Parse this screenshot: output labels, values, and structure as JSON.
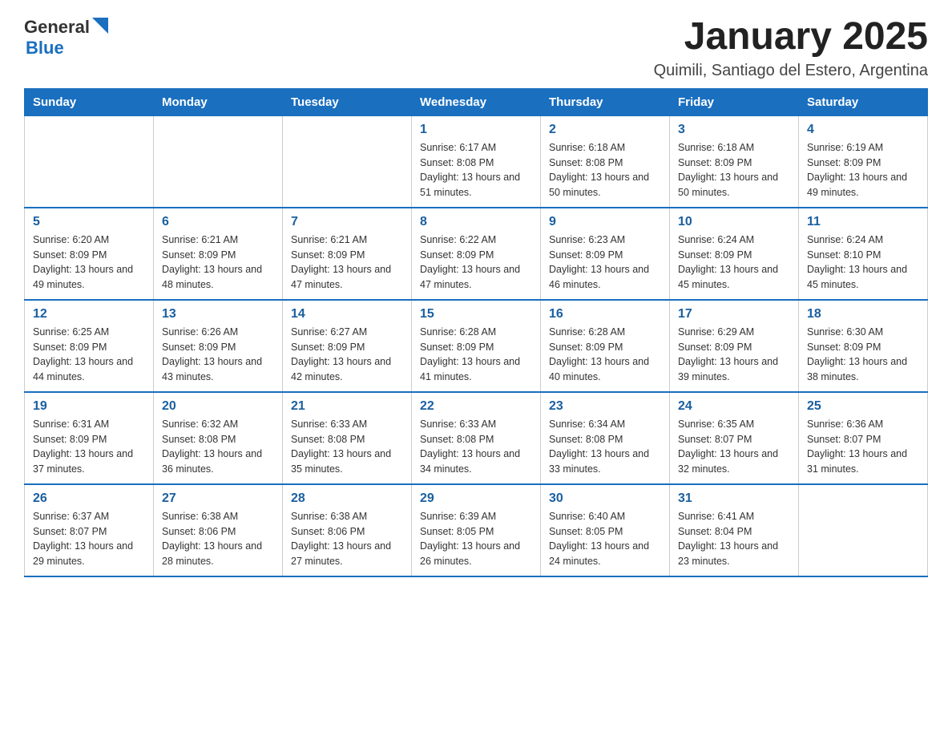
{
  "header": {
    "logo": {
      "general": "General",
      "blue": "Blue"
    },
    "title": "January 2025",
    "subtitle": "Quimili, Santiago del Estero, Argentina"
  },
  "weekdays": [
    "Sunday",
    "Monday",
    "Tuesday",
    "Wednesday",
    "Thursday",
    "Friday",
    "Saturday"
  ],
  "weeks": [
    [
      {
        "day": "",
        "info": ""
      },
      {
        "day": "",
        "info": ""
      },
      {
        "day": "",
        "info": ""
      },
      {
        "day": "1",
        "info": "Sunrise: 6:17 AM\nSunset: 8:08 PM\nDaylight: 13 hours and 51 minutes."
      },
      {
        "day": "2",
        "info": "Sunrise: 6:18 AM\nSunset: 8:08 PM\nDaylight: 13 hours and 50 minutes."
      },
      {
        "day": "3",
        "info": "Sunrise: 6:18 AM\nSunset: 8:09 PM\nDaylight: 13 hours and 50 minutes."
      },
      {
        "day": "4",
        "info": "Sunrise: 6:19 AM\nSunset: 8:09 PM\nDaylight: 13 hours and 49 minutes."
      }
    ],
    [
      {
        "day": "5",
        "info": "Sunrise: 6:20 AM\nSunset: 8:09 PM\nDaylight: 13 hours and 49 minutes."
      },
      {
        "day": "6",
        "info": "Sunrise: 6:21 AM\nSunset: 8:09 PM\nDaylight: 13 hours and 48 minutes."
      },
      {
        "day": "7",
        "info": "Sunrise: 6:21 AM\nSunset: 8:09 PM\nDaylight: 13 hours and 47 minutes."
      },
      {
        "day": "8",
        "info": "Sunrise: 6:22 AM\nSunset: 8:09 PM\nDaylight: 13 hours and 47 minutes."
      },
      {
        "day": "9",
        "info": "Sunrise: 6:23 AM\nSunset: 8:09 PM\nDaylight: 13 hours and 46 minutes."
      },
      {
        "day": "10",
        "info": "Sunrise: 6:24 AM\nSunset: 8:09 PM\nDaylight: 13 hours and 45 minutes."
      },
      {
        "day": "11",
        "info": "Sunrise: 6:24 AM\nSunset: 8:10 PM\nDaylight: 13 hours and 45 minutes."
      }
    ],
    [
      {
        "day": "12",
        "info": "Sunrise: 6:25 AM\nSunset: 8:09 PM\nDaylight: 13 hours and 44 minutes."
      },
      {
        "day": "13",
        "info": "Sunrise: 6:26 AM\nSunset: 8:09 PM\nDaylight: 13 hours and 43 minutes."
      },
      {
        "day": "14",
        "info": "Sunrise: 6:27 AM\nSunset: 8:09 PM\nDaylight: 13 hours and 42 minutes."
      },
      {
        "day": "15",
        "info": "Sunrise: 6:28 AM\nSunset: 8:09 PM\nDaylight: 13 hours and 41 minutes."
      },
      {
        "day": "16",
        "info": "Sunrise: 6:28 AM\nSunset: 8:09 PM\nDaylight: 13 hours and 40 minutes."
      },
      {
        "day": "17",
        "info": "Sunrise: 6:29 AM\nSunset: 8:09 PM\nDaylight: 13 hours and 39 minutes."
      },
      {
        "day": "18",
        "info": "Sunrise: 6:30 AM\nSunset: 8:09 PM\nDaylight: 13 hours and 38 minutes."
      }
    ],
    [
      {
        "day": "19",
        "info": "Sunrise: 6:31 AM\nSunset: 8:09 PM\nDaylight: 13 hours and 37 minutes."
      },
      {
        "day": "20",
        "info": "Sunrise: 6:32 AM\nSunset: 8:08 PM\nDaylight: 13 hours and 36 minutes."
      },
      {
        "day": "21",
        "info": "Sunrise: 6:33 AM\nSunset: 8:08 PM\nDaylight: 13 hours and 35 minutes."
      },
      {
        "day": "22",
        "info": "Sunrise: 6:33 AM\nSunset: 8:08 PM\nDaylight: 13 hours and 34 minutes."
      },
      {
        "day": "23",
        "info": "Sunrise: 6:34 AM\nSunset: 8:08 PM\nDaylight: 13 hours and 33 minutes."
      },
      {
        "day": "24",
        "info": "Sunrise: 6:35 AM\nSunset: 8:07 PM\nDaylight: 13 hours and 32 minutes."
      },
      {
        "day": "25",
        "info": "Sunrise: 6:36 AM\nSunset: 8:07 PM\nDaylight: 13 hours and 31 minutes."
      }
    ],
    [
      {
        "day": "26",
        "info": "Sunrise: 6:37 AM\nSunset: 8:07 PM\nDaylight: 13 hours and 29 minutes."
      },
      {
        "day": "27",
        "info": "Sunrise: 6:38 AM\nSunset: 8:06 PM\nDaylight: 13 hours and 28 minutes."
      },
      {
        "day": "28",
        "info": "Sunrise: 6:38 AM\nSunset: 8:06 PM\nDaylight: 13 hours and 27 minutes."
      },
      {
        "day": "29",
        "info": "Sunrise: 6:39 AM\nSunset: 8:05 PM\nDaylight: 13 hours and 26 minutes."
      },
      {
        "day": "30",
        "info": "Sunrise: 6:40 AM\nSunset: 8:05 PM\nDaylight: 13 hours and 24 minutes."
      },
      {
        "day": "31",
        "info": "Sunrise: 6:41 AM\nSunset: 8:04 PM\nDaylight: 13 hours and 23 minutes."
      },
      {
        "day": "",
        "info": ""
      }
    ]
  ]
}
